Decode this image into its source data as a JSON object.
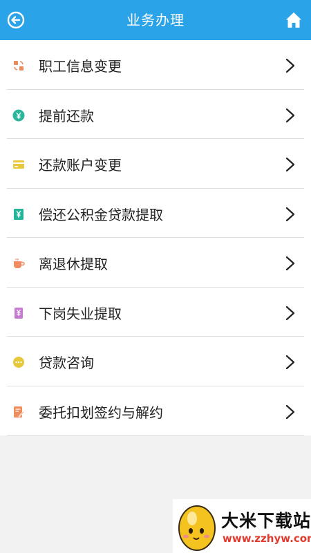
{
  "header": {
    "title": "业务办理",
    "background": "#2aa3e8",
    "back_icon": "back-arrow-circle-icon",
    "home_icon": "home-icon"
  },
  "menu": [
    {
      "label": "职工信息变更",
      "icon": "info-change-icon",
      "icon_color": "#e98b5b"
    },
    {
      "label": "提前还款",
      "icon": "yuan-circle-icon",
      "icon_color": "#29b69a"
    },
    {
      "label": "还款账户变更",
      "icon": "card-icon",
      "icon_color": "#e8c93b"
    },
    {
      "label": "偿还公积金贷款提取",
      "icon": "receipt-yuan-icon",
      "icon_color": "#24b49a"
    },
    {
      "label": "离退休提取",
      "icon": "coffee-cup-icon",
      "icon_color": "#ef8c62"
    },
    {
      "label": "下岗失业提取",
      "icon": "document-yuan-icon",
      "icon_color": "#c77ad1"
    },
    {
      "label": "贷款咨询",
      "icon": "chat-bubble-icon",
      "icon_color": "#e6c93a"
    },
    {
      "label": "委托扣划签约与解约",
      "icon": "edit-document-icon",
      "icon_color": "#ef8c5c"
    }
  ],
  "watermark": {
    "name": "大米下载站",
    "url": "www.zzhyw.com"
  }
}
